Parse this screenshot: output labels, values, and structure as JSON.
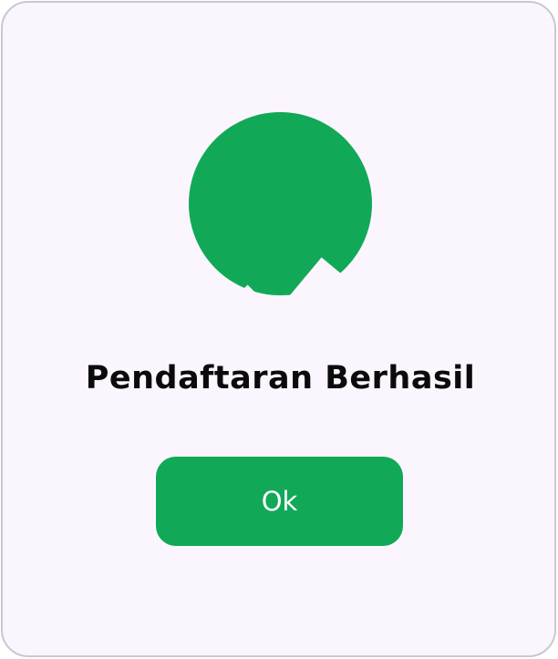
{
  "dialog": {
    "icon": "checkmark-circle-icon",
    "title": "Pendaftaran Berhasil",
    "ok_label": "Ok"
  },
  "colors": {
    "accent": "#11a957",
    "background": "#fbf6fd",
    "border": "#cbc7d0",
    "text": "#0b0b0b",
    "button_text": "#ffffff"
  }
}
